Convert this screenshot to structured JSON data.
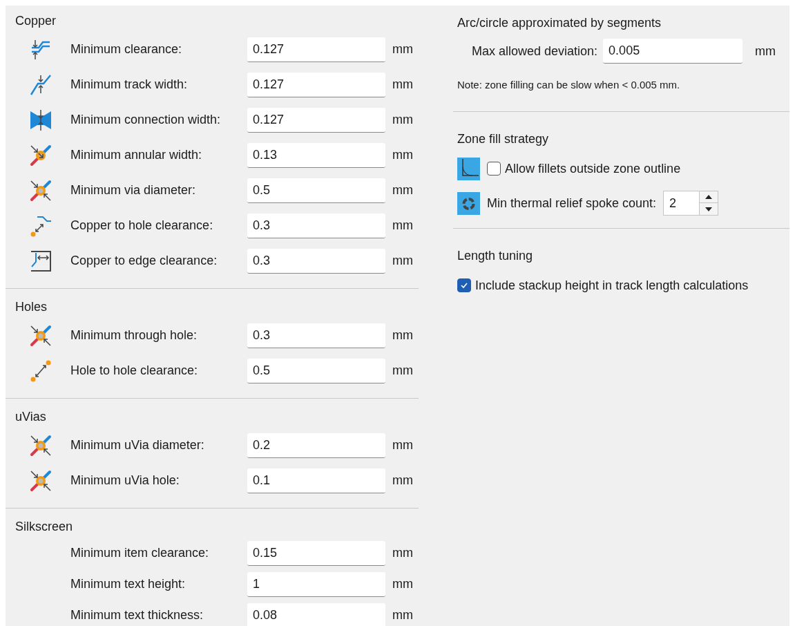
{
  "left_sections": [
    {
      "title": "Copper",
      "rows": [
        {
          "kind": "clearance",
          "label": "Minimum clearance:",
          "value": "0.127",
          "unit": "mm"
        },
        {
          "kind": "track",
          "label": "Minimum track width:",
          "value": "0.127",
          "unit": "mm"
        },
        {
          "kind": "connection",
          "label": "Minimum connection width:",
          "value": "0.127",
          "unit": "mm"
        },
        {
          "kind": "annular",
          "label": "Minimum annular width:",
          "value": "0.13",
          "unit": "mm"
        },
        {
          "kind": "via",
          "label": "Minimum via diameter:",
          "value": "0.5",
          "unit": "mm"
        },
        {
          "kind": "hole_clearance",
          "label": "Copper to hole clearance:",
          "value": "0.3",
          "unit": "mm"
        },
        {
          "kind": "edge",
          "label": "Copper to edge clearance:",
          "value": "0.3",
          "unit": "mm"
        }
      ]
    },
    {
      "title": "Holes",
      "rows": [
        {
          "kind": "through",
          "label": "Minimum through hole:",
          "value": "0.3",
          "unit": "mm"
        },
        {
          "kind": "hole_to_hole",
          "label": "Hole to hole clearance:",
          "value": "0.5",
          "unit": "mm"
        }
      ]
    },
    {
      "title": "uVias",
      "rows": [
        {
          "kind": "via",
          "label": "Minimum uVia diameter:",
          "value": "0.2",
          "unit": "mm"
        },
        {
          "kind": "through",
          "label": "Minimum uVia hole:",
          "value": "0.1",
          "unit": "mm"
        }
      ]
    },
    {
      "title": "Silkscreen",
      "rows": [
        {
          "kind": "plain",
          "label": "Minimum item clearance:",
          "value": "0.15",
          "unit": "mm"
        },
        {
          "kind": "plain",
          "label": "Minimum text height:",
          "value": "1",
          "unit": "mm"
        },
        {
          "kind": "plain",
          "label": "Minimum text thickness:",
          "value": "0.08",
          "unit": "mm"
        }
      ]
    }
  ],
  "arc": {
    "title": "Arc/circle approximated by segments",
    "field": {
      "label": "Max allowed deviation:",
      "value": "0.005",
      "unit": "mm"
    },
    "note": "Note: zone filling can be slow when < 0.005 mm."
  },
  "zone_fill": {
    "title": "Zone fill strategy",
    "fillets": {
      "label": "Allow fillets outside zone outline",
      "checked": false
    },
    "spokes": {
      "label": "Min thermal relief spoke count:",
      "value": "2"
    }
  },
  "length_tuning": {
    "title": "Length tuning",
    "option": {
      "label": "Include stackup height in track length calculations",
      "checked": true
    }
  }
}
